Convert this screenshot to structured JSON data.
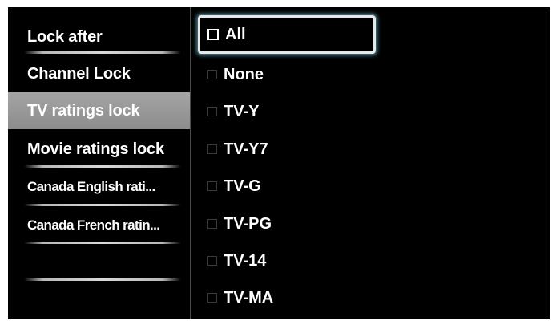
{
  "left_menu": {
    "items": [
      {
        "label": "Lock after"
      },
      {
        "label": "Channel Lock"
      },
      {
        "label": "TV ratings lock"
      },
      {
        "label": "Movie ratings lock"
      },
      {
        "label": "Canada English rati..."
      },
      {
        "label": "Canada French ratin..."
      },
      {
        "label": ""
      }
    ],
    "selected": "TV ratings lock"
  },
  "ratings": {
    "options": [
      {
        "label": "All",
        "checked": false
      },
      {
        "label": "None",
        "checked": false
      },
      {
        "label": "TV-Y",
        "checked": false
      },
      {
        "label": "TV-Y7",
        "checked": false
      },
      {
        "label": "TV-G",
        "checked": false
      },
      {
        "label": "TV-PG",
        "checked": false
      },
      {
        "label": "TV-14",
        "checked": false
      },
      {
        "label": "TV-MA",
        "checked": false
      }
    ],
    "focused": "All"
  },
  "colors": {
    "background": "#000000",
    "selected_item": "#999999",
    "focus_glow": "#78c8dc",
    "text": "#ffffff"
  }
}
